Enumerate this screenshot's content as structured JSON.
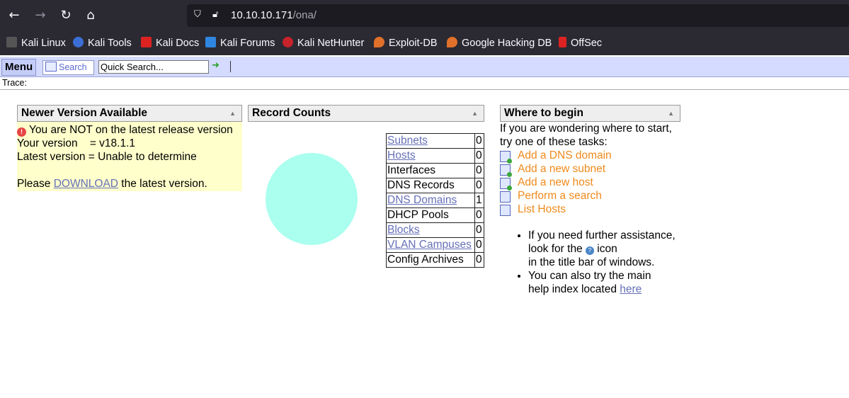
{
  "browser": {
    "url_host": "10.10.10.171",
    "url_path": "/ona/",
    "bookmarks": [
      "Kali Linux",
      "Kali Tools",
      "Kali Docs",
      "Kali Forums",
      "Kali NetHunter",
      "Exploit-DB",
      "Google Hacking DB",
      "OffSec"
    ]
  },
  "toolbar": {
    "menu_label": "Menu",
    "search_label": "Search",
    "quick_search_value": "Quick Search...",
    "trace_label": "Trace:"
  },
  "newer_version": {
    "title": "Newer Version Available",
    "line1": "You are NOT on the latest release version",
    "line2": "Your version    = v18.1.1",
    "line3": "Latest version = Unable to determine",
    "line4_prefix": "Please ",
    "download_link": "DOWNLOAD",
    "line4_suffix": " the latest version."
  },
  "record_counts": {
    "title": "Record Counts",
    "rows": [
      {
        "label": "Subnets",
        "count": "0"
      },
      {
        "label": "Hosts",
        "count": "0"
      },
      {
        "label": "Interfaces",
        "count": "0"
      },
      {
        "label": "DNS Records",
        "count": "0"
      },
      {
        "label": "DNS Domains",
        "count": "1"
      },
      {
        "label": "DHCP Pools",
        "count": "0"
      },
      {
        "label": "Blocks",
        "count": "0"
      },
      {
        "label": "VLAN Campuses",
        "count": "0"
      },
      {
        "label": "Config Archives",
        "count": "0"
      }
    ],
    "pie_color": "#aaffee"
  },
  "where_to_begin": {
    "title": "Where to begin",
    "intro1": "If you are wondering where to start,",
    "intro2": "try one of these tasks:",
    "tasks": [
      "Add a DNS domain",
      "Add a new subnet",
      "Add a new host",
      "Perform a search",
      "List Hosts"
    ],
    "help1_a": "If you need further assistance,",
    "help1_b_prefix": "look for the ",
    "help1_b_suffix": " icon",
    "help1_c": "in the title bar of windows.",
    "help2_a": "You can also try the main",
    "help2_b_prefix": "help index located ",
    "help2_link": "here"
  }
}
